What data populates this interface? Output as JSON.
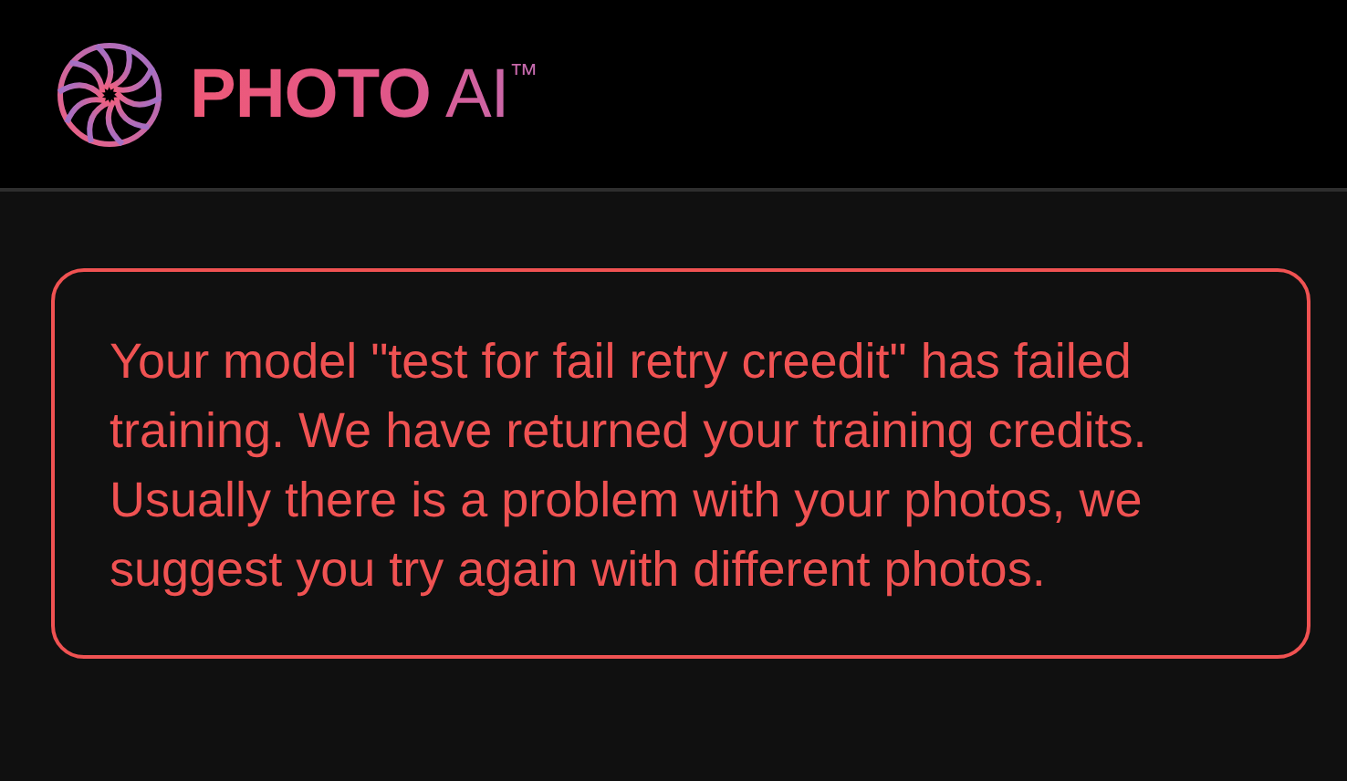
{
  "header": {
    "logo": {
      "name": "PHOTO",
      "suffix": "AI",
      "mark": "™"
    }
  },
  "alert": {
    "kind": "error",
    "message": "Your model \"test for fail retry creedit\" has failed training. We have returned your training credits. Usually there is a problem with your photos, we suggest you try again with different photos."
  }
}
